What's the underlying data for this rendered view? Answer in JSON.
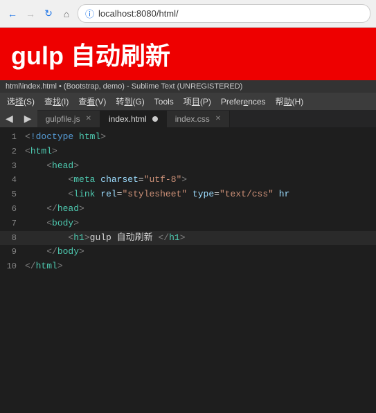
{
  "browser": {
    "url": "localhost:8080/html/",
    "back_label": "←",
    "forward_label": "→",
    "reload_label": "↻",
    "home_label": "⌂"
  },
  "webpage": {
    "title": "gulp 自动刷新"
  },
  "sublime": {
    "titlebar": "html\\index.html • (Bootstrap, demo) - Sublime Text (UNREGISTERED)",
    "menu": {
      "items": [
        "选择(S)",
        "查找(I)",
        "查看(V)",
        "转到(G)",
        "Tools",
        "项目(P)",
        "Preferences",
        "帮助(H)"
      ]
    },
    "tabs": [
      {
        "name": "gulpfile.js",
        "active": false,
        "indicator": "close"
      },
      {
        "name": "index.html",
        "active": true,
        "indicator": "dot"
      },
      {
        "name": "index.css",
        "active": false,
        "indicator": "close"
      }
    ],
    "code_lines": [
      {
        "num": 1,
        "content": "<!doctype html>"
      },
      {
        "num": 2,
        "content": "<html>"
      },
      {
        "num": 3,
        "content": "    <head>"
      },
      {
        "num": 4,
        "content": "        <meta charset=\"utf-8\">"
      },
      {
        "num": 5,
        "content": "        <link rel=\"stylesheet\" type=\"text/css\" hr"
      },
      {
        "num": 6,
        "content": "    </head>"
      },
      {
        "num": 7,
        "content": "    <body>"
      },
      {
        "num": 8,
        "content": "        <h1>gulp 自动刷新 </h1>"
      },
      {
        "num": 9,
        "content": "    </body>"
      },
      {
        "num": 10,
        "content": "</html>"
      }
    ]
  }
}
